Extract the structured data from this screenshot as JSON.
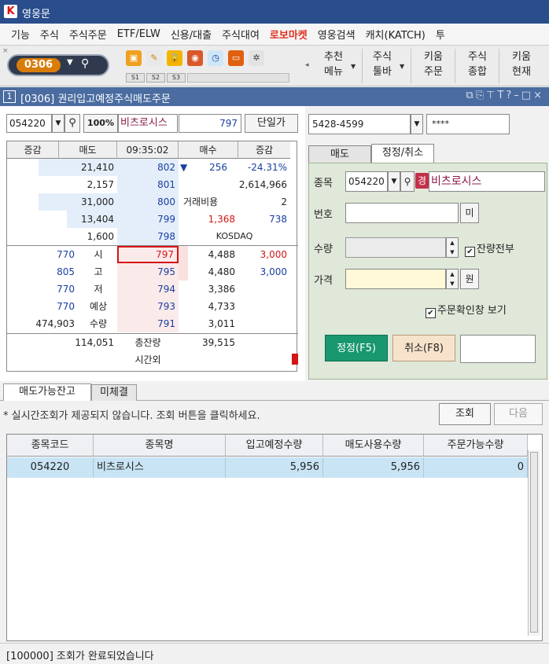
{
  "app": {
    "title": "영웅문"
  },
  "menu": [
    {
      "label": "기능",
      "highlight": false
    },
    {
      "label": "주식",
      "highlight": false
    },
    {
      "label": "주식주문",
      "highlight": false
    },
    {
      "label": "ETF/ELW",
      "highlight": false
    },
    {
      "label": "신용/대출",
      "highlight": false
    },
    {
      "label": "주식대여",
      "highlight": false
    },
    {
      "label": "로보마켓",
      "highlight": true
    },
    {
      "label": "영웅검색",
      "highlight": false
    },
    {
      "label": "캐치(KATCH)",
      "highlight": false
    },
    {
      "label": "투",
      "highlight": false
    }
  ],
  "toolbar": {
    "screen_code": "0306",
    "screen_tabs": [
      "S1",
      "S2",
      "S3"
    ],
    "buttons": [
      {
        "top": "추천",
        "bottom": "메뉴"
      },
      {
        "top": "주식",
        "bottom": "툴바"
      },
      {
        "top": "키움",
        "bottom": "주문"
      },
      {
        "top": "주식",
        "bottom": "종합"
      },
      {
        "top": "키움",
        "bottom": "현재"
      }
    ]
  },
  "window": {
    "number": "1",
    "title": "[0306] 권리입고예정주식매도주문"
  },
  "order_panel": {
    "stock_code": "054220",
    "pct": "100%",
    "stock_name": "비츠로시스",
    "price": "797",
    "unit_button": "단일가"
  },
  "orderbook": {
    "headers": {
      "diff_left": "증감",
      "ask": "매도",
      "time": "09:35:02",
      "bid": "매수",
      "diff_right": "증감"
    },
    "asks": [
      {
        "qty": "21,410",
        "price": "802"
      },
      {
        "qty": "2,157",
        "price": "801"
      },
      {
        "qty": "31,000",
        "price": "800"
      },
      {
        "qty": "13,404",
        "price": "799"
      },
      {
        "qty": "1,600",
        "price": "798"
      }
    ],
    "info": {
      "change_arrow": "▼",
      "change": "256",
      "change_pct": "-24.31%",
      "volume": "2,614,966",
      "cost_label": "거래비용",
      "cost_value": "2",
      "exp_price": "1,368",
      "exp_qty": "738",
      "market": "KOSDAQ"
    },
    "bids": [
      {
        "price": "797",
        "qty": "4,488",
        "diff": "3,000"
      },
      {
        "price": "795",
        "qty": "4,480",
        "diff": "3,000"
      },
      {
        "price": "794",
        "qty": "3,386",
        "diff": ""
      },
      {
        "price": "793",
        "qty": "4,733",
        "diff": ""
      },
      {
        "price": "791",
        "qty": "3,011",
        "diff": ""
      }
    ],
    "summary": [
      {
        "value": "770",
        "label": "시"
      },
      {
        "value": "805",
        "label": "고"
      },
      {
        "value": "770",
        "label": "저"
      },
      {
        "value": "770",
        "label": "예상"
      },
      {
        "value": "474,903",
        "label": "수량"
      }
    ],
    "total": {
      "ask": "114,051",
      "label": "총잔량",
      "bid": "39,515",
      "after_label": "시간외"
    }
  },
  "account": {
    "number": "5428-4599",
    "password": "****"
  },
  "tabs": {
    "sell": "매도",
    "modify": "정정/취소"
  },
  "form": {
    "code_label": "종목",
    "code": "054220",
    "badge": "경",
    "name": "비츠로시스",
    "no_label": "번호",
    "no_button": "미",
    "qty_label": "수량",
    "remaining_label": "잔량전부",
    "price_label": "가격",
    "won_button": "원",
    "confirm_label": "주문확인창 보기",
    "check_mark": "✔",
    "modify_button": "정정(F5)",
    "cancel_button": "취소(F8)"
  },
  "bottom": {
    "tab1": "매도가능잔고",
    "tab2": "미체결",
    "notice": "* 실시간조회가 제공되지 않습니다. 조회 버튼을 클릭하세요.",
    "query_button": "조회",
    "next_button": "다음"
  },
  "grid": {
    "headers": [
      "종목코드",
      "종목명",
      "입고예정수량",
      "매도사용수량",
      "주문가능수량"
    ],
    "rows": [
      {
        "code": "054220",
        "name": "비츠로시스",
        "incoming": "5,956",
        "sell_used": "5,956",
        "available": "0"
      }
    ]
  },
  "status": {
    "text": "[100000] 조회가 완료되었습니다"
  },
  "colors": {
    "titlebar": "#2a4e8c",
    "window_title": "#4a6ca0",
    "ask_blue": "#1a3fa0",
    "bid_red": "#d41515",
    "form_green": "#dfe8d9",
    "modify_button": "#19976f"
  }
}
